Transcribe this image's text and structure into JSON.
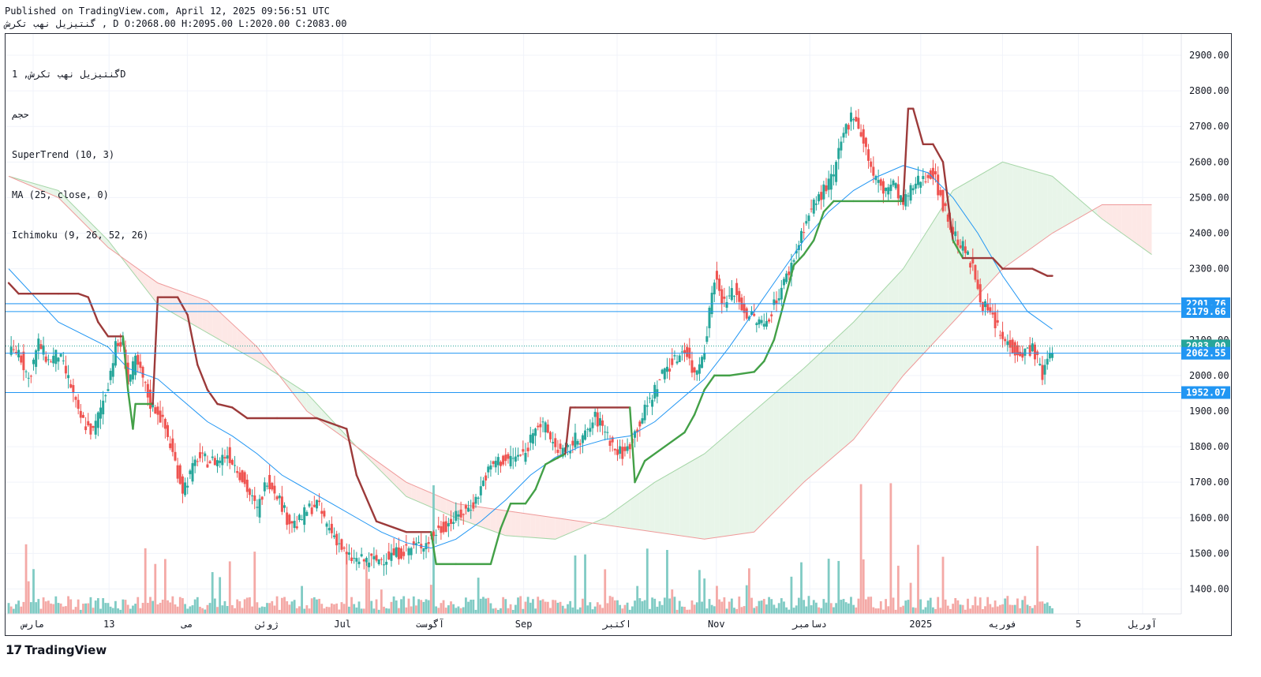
{
  "header": {
    "published": "Published on TradingView.com, April 12, 2025 09:56:51 UTC",
    "ohlc_line": "گنتیزیل نهب تکرش , D O:2068.00 H:2095.00 L:2020.00 C:2083.00"
  },
  "legend": {
    "symbol": "گنتیزیل نهب تکرش, 1D",
    "volume": "حجم",
    "supertrend": "SuperTrend (10, 3)",
    "ma": "MA (25, close, 0)",
    "ichimoku": "Ichimoku (9, 26, 52, 26)"
  },
  "branding": {
    "logo_text": "TradingView"
  },
  "colors": {
    "up": "#26a69a",
    "down": "#ef5350",
    "supertrend_up": "#43a047",
    "supertrend_down": "#9c3a3a",
    "ma": "#2196f3",
    "cloud_bull": "#e8f5e9",
    "cloud_bear": "#fde8e6",
    "level_line": "#2196f3"
  },
  "chart_data": {
    "type": "candlestick",
    "title": "",
    "ylim": [
      1330,
      2960
    ],
    "y_ticks": [
      1400,
      1500,
      1600,
      1700,
      1800,
      1900,
      2000,
      2100,
      2200,
      2300,
      2400,
      2500,
      2600,
      2700,
      2800,
      2900
    ],
    "x_ticks": [
      {
        "label": "مارس",
        "at": 0.0
      },
      {
        "label": "13",
        "at": 0.065
      },
      {
        "label": "می",
        "at": 0.132
      },
      {
        "label": "ژوئن",
        "at": 0.2
      },
      {
        "label": "Jul",
        "at": 0.265
      },
      {
        "label": "آگوست",
        "at": 0.34
      },
      {
        "label": "Sep",
        "at": 0.42
      },
      {
        "label": "اکتبر",
        "at": 0.5
      },
      {
        "label": "Nov",
        "at": 0.585
      },
      {
        "label": "دسامبر",
        "at": 0.665
      },
      {
        "label": "2025",
        "at": 0.76
      },
      {
        "label": "فوریه",
        "at": 0.83
      },
      {
        "label": "5",
        "at": 0.895
      },
      {
        "label": "آوریل",
        "at": 0.95
      }
    ],
    "price_labels": [
      {
        "value": 2201.76,
        "label": "2201.76",
        "line": true
      },
      {
        "value": 2179.66,
        "label": "2179.66",
        "line": true
      },
      {
        "value": 2083.0,
        "label": "2083.00",
        "line": false,
        "current": true
      },
      {
        "value": 2062.55,
        "label": "2062.55",
        "line": true
      },
      {
        "value": 1952.07,
        "label": "1952.07",
        "line": true
      }
    ],
    "close_path": [
      [
        0,
        2060
      ],
      [
        4,
        2070
      ],
      [
        8,
        1990
      ],
      [
        12,
        2090
      ],
      [
        16,
        2040
      ],
      [
        20,
        2060
      ],
      [
        25,
        1970
      ],
      [
        28,
        1890
      ],
      [
        31,
        1860
      ],
      [
        34,
        1840
      ],
      [
        38,
        1930
      ],
      [
        40,
        1980
      ],
      [
        43,
        2080
      ],
      [
        46,
        2090
      ],
      [
        48,
        1980
      ],
      [
        51,
        2040
      ],
      [
        54,
        1990
      ],
      [
        57,
        1920
      ],
      [
        60,
        1900
      ],
      [
        63,
        1850
      ],
      [
        66,
        1780
      ],
      [
        70,
        1680
      ],
      [
        73,
        1720
      ],
      [
        76,
        1770
      ],
      [
        80,
        1760
      ],
      [
        84,
        1760
      ],
      [
        88,
        1780
      ],
      [
        92,
        1740
      ],
      [
        96,
        1680
      ],
      [
        100,
        1620
      ],
      [
        104,
        1710
      ],
      [
        108,
        1670
      ],
      [
        112,
        1600
      ],
      [
        116,
        1580
      ],
      [
        120,
        1620
      ],
      [
        124,
        1640
      ],
      [
        128,
        1580
      ],
      [
        132,
        1540
      ],
      [
        136,
        1490
      ],
      [
        140,
        1480
      ],
      [
        144,
        1480
      ],
      [
        148,
        1480
      ],
      [
        152,
        1490
      ],
      [
        156,
        1500
      ],
      [
        160,
        1510
      ],
      [
        164,
        1520
      ],
      [
        168,
        1530
      ],
      [
        172,
        1560
      ],
      [
        176,
        1580
      ],
      [
        180,
        1600
      ],
      [
        184,
        1620
      ],
      [
        188,
        1650
      ],
      [
        192,
        1720
      ],
      [
        196,
        1760
      ],
      [
        200,
        1760
      ],
      [
        204,
        1770
      ],
      [
        208,
        1780
      ],
      [
        212,
        1870
      ],
      [
        216,
        1850
      ],
      [
        220,
        1800
      ],
      [
        224,
        1780
      ],
      [
        228,
        1820
      ],
      [
        232,
        1830
      ],
      [
        236,
        1880
      ],
      [
        240,
        1850
      ],
      [
        244,
        1790
      ],
      [
        248,
        1780
      ],
      [
        252,
        1840
      ],
      [
        256,
        1900
      ],
      [
        260,
        1960
      ],
      [
        264,
        2020
      ],
      [
        268,
        2040
      ],
      [
        272,
        2080
      ],
      [
        276,
        2000
      ],
      [
        280,
        2080
      ],
      [
        284,
        2280
      ],
      [
        288,
        2200
      ],
      [
        292,
        2240
      ],
      [
        296,
        2180
      ],
      [
        300,
        2160
      ],
      [
        304,
        2140
      ],
      [
        308,
        2200
      ],
      [
        312,
        2260
      ],
      [
        316,
        2330
      ],
      [
        320,
        2420
      ],
      [
        324,
        2480
      ],
      [
        328,
        2520
      ],
      [
        332,
        2560
      ],
      [
        336,
        2680
      ],
      [
        340,
        2740
      ],
      [
        344,
        2660
      ],
      [
        348,
        2560
      ],
      [
        352,
        2520
      ],
      [
        356,
        2540
      ],
      [
        360,
        2480
      ],
      [
        364,
        2530
      ],
      [
        368,
        2560
      ],
      [
        372,
        2570
      ],
      [
        376,
        2480
      ],
      [
        380,
        2400
      ],
      [
        384,
        2360
      ],
      [
        388,
        2300
      ],
      [
        392,
        2200
      ],
      [
        396,
        2160
      ],
      [
        400,
        2100
      ],
      [
        404,
        2080
      ],
      [
        408,
        2060
      ],
      [
        412,
        2080
      ],
      [
        416,
        2000
      ],
      [
        420,
        2083
      ]
    ],
    "series": [
      {
        "name": "SuperTrend (10, 3)",
        "values_ref": "supertrend"
      },
      {
        "name": "MA (25, close, 0)",
        "values_ref": "ma"
      },
      {
        "name": "Ichimoku (9, 26, 52, 26)",
        "values_ref": "ichimoku"
      }
    ],
    "supertrend": [
      [
        0,
        2260
      ],
      [
        4,
        2230
      ],
      [
        8,
        2230
      ],
      [
        20,
        2230
      ],
      [
        28,
        2230
      ],
      [
        32,
        2220
      ],
      [
        36,
        2150
      ],
      [
        40,
        2110
      ],
      [
        46,
        2110
      ],
      [
        48,
        1960
      ],
      [
        50,
        1850
      ],
      [
        51,
        1920
      ],
      [
        58,
        1920
      ],
      [
        60,
        2220
      ],
      [
        68,
        2220
      ],
      [
        72,
        2170
      ],
      [
        76,
        2030
      ],
      [
        80,
        1960
      ],
      [
        84,
        1920
      ],
      [
        90,
        1910
      ],
      [
        96,
        1880
      ],
      [
        108,
        1880
      ],
      [
        124,
        1880
      ],
      [
        136,
        1850
      ],
      [
        140,
        1720
      ],
      [
        148,
        1590
      ],
      [
        160,
        1560
      ],
      [
        170,
        1560
      ],
      [
        172,
        1470
      ],
      [
        180,
        1470
      ],
      [
        194,
        1470
      ],
      [
        198,
        1570
      ],
      [
        202,
        1640
      ],
      [
        208,
        1640
      ],
      [
        212,
        1680
      ],
      [
        216,
        1750
      ],
      [
        224,
        1780
      ],
      [
        226,
        1910
      ],
      [
        228,
        1910
      ],
      [
        250,
        1910
      ],
      [
        252,
        1700
      ],
      [
        256,
        1760
      ],
      [
        264,
        1800
      ],
      [
        272,
        1840
      ],
      [
        276,
        1890
      ],
      [
        280,
        1960
      ],
      [
        284,
        2000
      ],
      [
        290,
        2000
      ],
      [
        300,
        2010
      ],
      [
        304,
        2040
      ],
      [
        308,
        2100
      ],
      [
        316,
        2310
      ],
      [
        320,
        2340
      ],
      [
        324,
        2380
      ],
      [
        328,
        2460
      ],
      [
        332,
        2490
      ],
      [
        340,
        2490
      ],
      [
        350,
        2490
      ],
      [
        360,
        2490
      ],
      [
        362,
        2750
      ],
      [
        364,
        2750
      ],
      [
        368,
        2650
      ],
      [
        372,
        2650
      ],
      [
        376,
        2600
      ],
      [
        380,
        2380
      ],
      [
        384,
        2330
      ],
      [
        396,
        2330
      ],
      [
        400,
        2300
      ],
      [
        412,
        2300
      ],
      [
        418,
        2280
      ],
      [
        420,
        2280
      ]
    ],
    "ma": [
      [
        0,
        2300
      ],
      [
        20,
        2150
      ],
      [
        40,
        2080
      ],
      [
        48,
        2020
      ],
      [
        60,
        1990
      ],
      [
        70,
        1930
      ],
      [
        80,
        1870
      ],
      [
        90,
        1830
      ],
      [
        100,
        1780
      ],
      [
        110,
        1720
      ],
      [
        120,
        1680
      ],
      [
        130,
        1640
      ],
      [
        140,
        1600
      ],
      [
        150,
        1560
      ],
      [
        160,
        1530
      ],
      [
        170,
        1515
      ],
      [
        180,
        1540
      ],
      [
        190,
        1590
      ],
      [
        200,
        1650
      ],
      [
        210,
        1720
      ],
      [
        220,
        1770
      ],
      [
        230,
        1800
      ],
      [
        240,
        1820
      ],
      [
        250,
        1830
      ],
      [
        260,
        1870
      ],
      [
        270,
        1930
      ],
      [
        280,
        1990
      ],
      [
        290,
        2080
      ],
      [
        300,
        2180
      ],
      [
        310,
        2280
      ],
      [
        320,
        2380
      ],
      [
        330,
        2460
      ],
      [
        340,
        2520
      ],
      [
        350,
        2560
      ],
      [
        360,
        2590
      ],
      [
        370,
        2570
      ],
      [
        380,
        2500
      ],
      [
        390,
        2400
      ],
      [
        400,
        2280
      ],
      [
        410,
        2180
      ],
      [
        420,
        2130
      ]
    ],
    "ichimoku_spans": {
      "span_a": [
        [
          0,
          2560
        ],
        [
          20,
          2520
        ],
        [
          40,
          2380
        ],
        [
          60,
          2200
        ],
        [
          80,
          2120
        ],
        [
          100,
          2040
        ],
        [
          120,
          1950
        ],
        [
          140,
          1800
        ],
        [
          160,
          1660
        ],
        [
          180,
          1600
        ],
        [
          200,
          1550
        ],
        [
          220,
          1540
        ],
        [
          240,
          1600
        ],
        [
          260,
          1700
        ],
        [
          280,
          1780
        ],
        [
          300,
          1900
        ],
        [
          320,
          2020
        ],
        [
          340,
          2150
        ],
        [
          360,
          2300
        ],
        [
          380,
          2520
        ],
        [
          400,
          2600
        ],
        [
          420,
          2560
        ],
        [
          440,
          2440
        ],
        [
          460,
          2340
        ]
      ],
      "span_b": [
        [
          0,
          2560
        ],
        [
          20,
          2500
        ],
        [
          40,
          2360
        ],
        [
          60,
          2260
        ],
        [
          80,
          2210
        ],
        [
          100,
          2080
        ],
        [
          120,
          1900
        ],
        [
          140,
          1800
        ],
        [
          160,
          1700
        ],
        [
          180,
          1640
        ],
        [
          200,
          1620
        ],
        [
          220,
          1600
        ],
        [
          240,
          1580
        ],
        [
          260,
          1560
        ],
        [
          280,
          1540
        ],
        [
          300,
          1560
        ],
        [
          320,
          1700
        ],
        [
          340,
          1820
        ],
        [
          360,
          2000
        ],
        [
          380,
          2150
        ],
        [
          400,
          2300
        ],
        [
          420,
          2400
        ],
        [
          440,
          2480
        ],
        [
          460,
          2480
        ]
      ]
    },
    "volume_note": "volume histogram at bottom"
  }
}
